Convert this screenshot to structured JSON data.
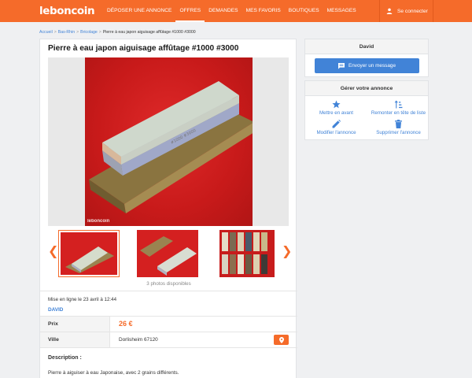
{
  "header": {
    "logo": "leboncoin",
    "nav": [
      {
        "label": "Déposer une annonce",
        "active": false
      },
      {
        "label": "Offres",
        "active": true
      },
      {
        "label": "Demandes",
        "active": false
      },
      {
        "label": "Mes favoris",
        "active": false
      },
      {
        "label": "Boutiques",
        "active": false
      },
      {
        "label": "Messages",
        "active": false
      }
    ],
    "login": "Se connecter"
  },
  "breadcrumb": [
    "Accueil",
    "Bas-Rhin",
    "Bricolage",
    "Pierre à eau japon aiguisage affûtage #1000 #3000"
  ],
  "ad": {
    "title": "Pierre à eau japon aiguisage affûtage #1000 #3000",
    "watermark": "leboncoin",
    "photos_count": "3 photos disponibles",
    "online": "Mise en ligne le 23 avril à 12:44",
    "seller": "DAVID",
    "price_label": "Prix",
    "price": "26 €",
    "city_label": "Ville",
    "city": "Dorlisheim 67120",
    "description_title": "Description :",
    "description": "Pierre à aiguiser à eau Japonaise, avec 2 grains différents."
  },
  "contact": {
    "name": "David",
    "send_label": "Envoyer un message"
  },
  "manage": {
    "title": "Gérer votre annonce",
    "actions": [
      "Mettre en avant",
      "Remonter en tête de liste",
      "Modifier l'annonce",
      "Supprimer l'annonce"
    ]
  },
  "colors": {
    "brand": "#f56b2a",
    "link": "#4183d7"
  },
  "icons": [
    "user-icon",
    "chevron-left-icon",
    "chevron-right-icon",
    "map-pin-icon",
    "chat-icon",
    "star-icon",
    "sort-up-icon",
    "pencil-icon",
    "trash-icon"
  ]
}
